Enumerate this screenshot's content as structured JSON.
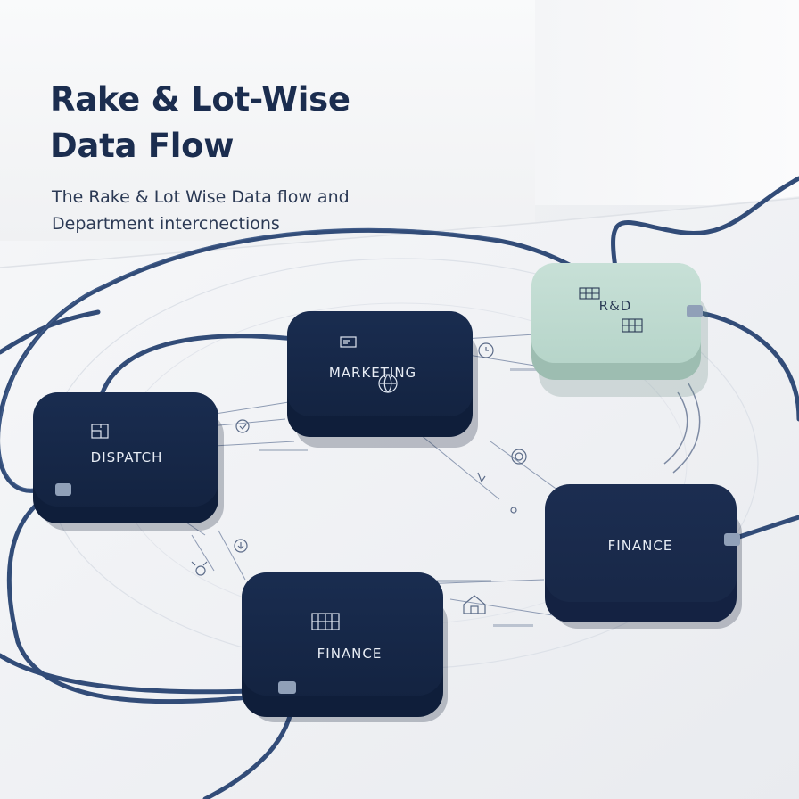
{
  "header": {
    "title": "Rake & Lot-Wise Data Flow",
    "subtitle": "The Rake & Lot Wise Data flow and Department intercnections"
  },
  "nodes": {
    "dispatch": {
      "label": "DISPATCH",
      "color": "#152646",
      "icon": "floorplan-icon"
    },
    "marketing": {
      "label": "MARKETING",
      "color": "#152646",
      "icon": "chart-icon"
    },
    "rnd": {
      "label": "R&D",
      "color": "#bcd9cf",
      "icon": "grid-icon"
    },
    "finance_right": {
      "label": "FINANCE",
      "color": "#1b2b4d"
    },
    "finance_bottom": {
      "label": "FINANCE",
      "color": "#152646",
      "icon": "calculator-icon"
    }
  },
  "colors": {
    "cable": "#324c78",
    "connector": "#90a0b8"
  }
}
